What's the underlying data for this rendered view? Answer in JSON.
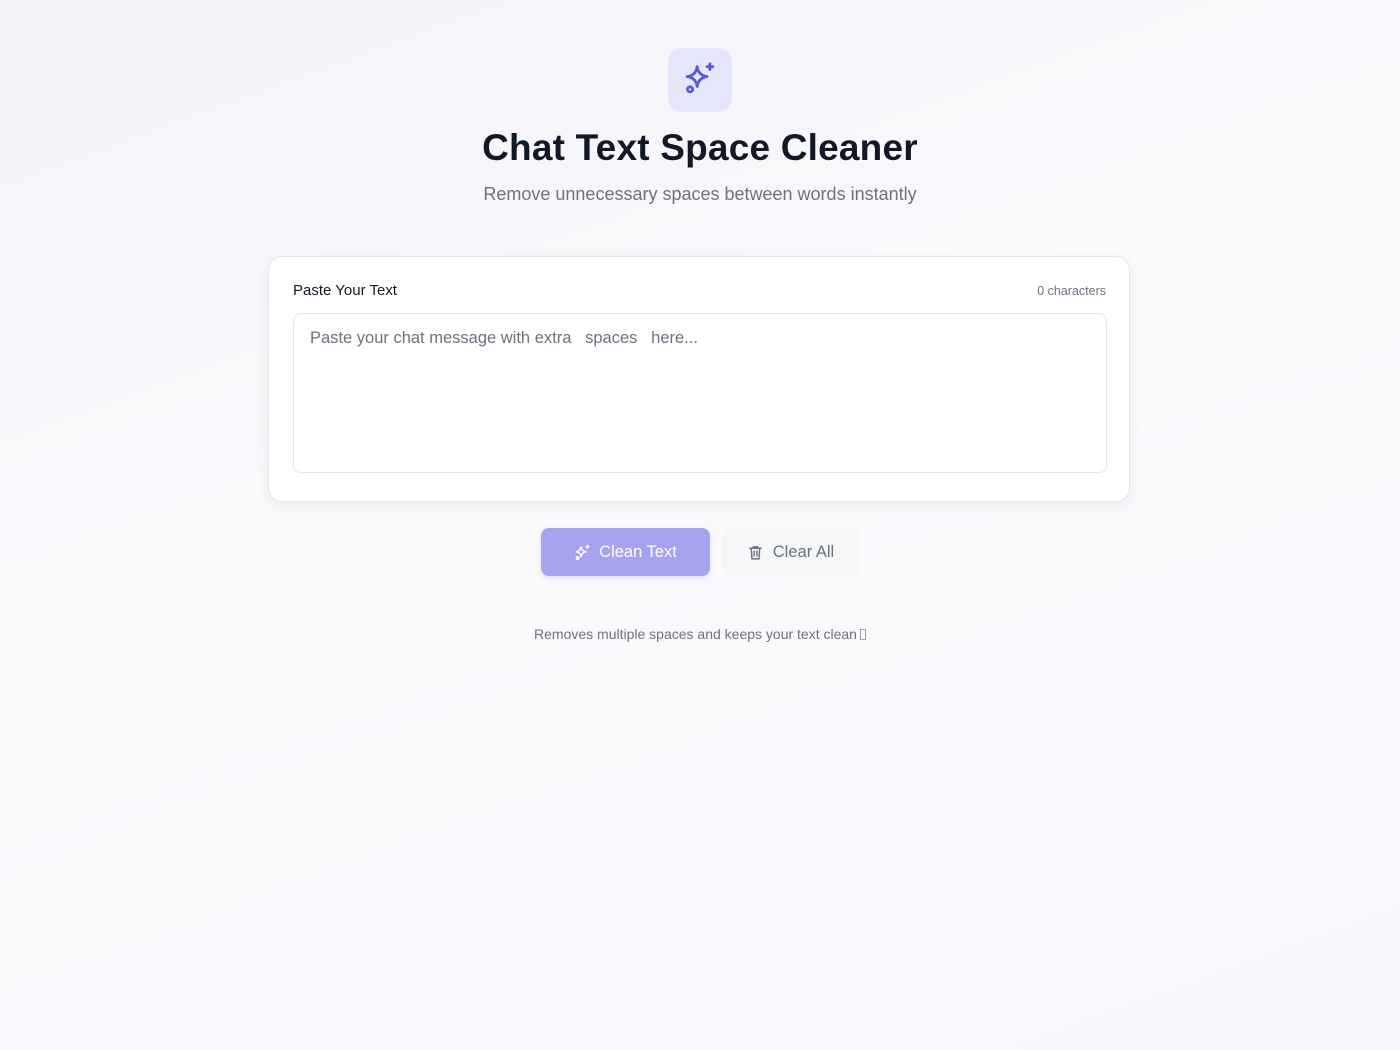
{
  "header": {
    "logo_icon": "sparkles-icon",
    "title": "Chat Text Space Cleaner",
    "subtitle": "Remove unnecessary spaces between words instantly"
  },
  "editor": {
    "label": "Paste Your Text",
    "char_count": "0 characters",
    "value": "",
    "placeholder": "Paste your chat message with extra   spaces   here..."
  },
  "actions": {
    "clean_label": "Clean Text",
    "clean_icon": "sparkles-icon",
    "clear_label": "Clear All",
    "clear_icon": "trash-icon"
  },
  "footer": {
    "note": "Removes multiple spaces and keeps your text clean"
  },
  "colors": {
    "accent": "#5b5bd6",
    "accent_tile": "#e6e6fa",
    "clean_button": "#a5a3ef",
    "clear_button": "#f5f6f8",
    "title_text": "#111827",
    "muted_text": "#6b7280"
  }
}
